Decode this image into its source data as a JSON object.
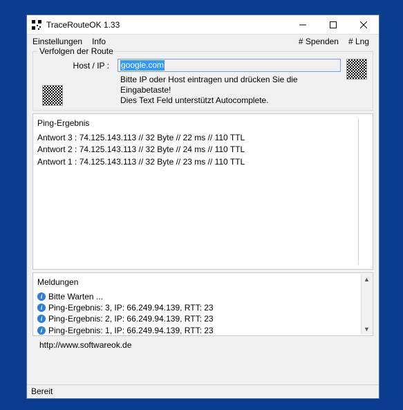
{
  "window": {
    "title": "TraceRouteOK 1.33"
  },
  "menu": {
    "settings": "Einstellungen",
    "info": "Info",
    "donate": "# Spenden",
    "lang": "# Lng"
  },
  "group": {
    "label": "Verfolgen der Route",
    "host_label": "Host / IP  :",
    "host_value": "google.com",
    "hint_line1": "Bitte IP oder Host eintragen und drücken Sie die Eingabetaste!",
    "hint_line2": "Dies Text Feld unterstützt Autocomplete."
  },
  "results": {
    "heading": "Ping-Ergebnis",
    "rows": [
      "Antwort 3 : 74.125.143.113  // 32 Byte //  22 ms // 110 TTL",
      "Antwort 2 : 74.125.143.113  // 32 Byte //  24 ms // 110 TTL",
      "Antwort 1 : 74.125.143.113  // 32 Byte //  23 ms // 110 TTL"
    ]
  },
  "messages": {
    "heading": "Meldungen",
    "rows": [
      "Bitte Warten ...",
      "Ping-Ergebnis: 3, IP: 66.249.94.139, RTT: 23",
      "Ping-Ergebnis: 2, IP: 66.249.94.139, RTT: 23",
      "Ping-Ergebnis: 1, IP: 66.249.94.139, RTT: 23"
    ]
  },
  "footer": {
    "url": "http://www.softwareok.de"
  },
  "status": {
    "text": "Bereit"
  }
}
